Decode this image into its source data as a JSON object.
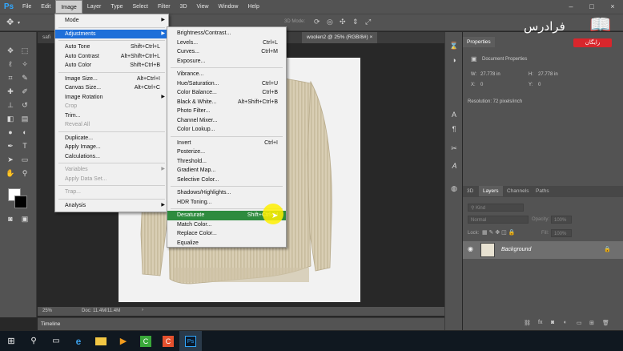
{
  "menubar": {
    "items": [
      "File",
      "Edit",
      "Image",
      "Layer",
      "Type",
      "Select",
      "Filter",
      "3D",
      "View",
      "Window",
      "Help"
    ],
    "active": "Image"
  },
  "optbar": {
    "mode_3d": "3D Mode:"
  },
  "tabs": [
    {
      "label": "safi"
    },
    {
      "label": "woolen2 @ 25% (RGB/8#)",
      "close": "×"
    }
  ],
  "statusbar": {
    "zoom": "25%",
    "doc": "Doc: 11.4M/11.4M"
  },
  "timeline": {
    "label": "Timeline"
  },
  "image_menu": {
    "items": [
      {
        "label": "Mode",
        "shortcut": "",
        "submenu": true,
        "disabled": false
      },
      {
        "sep": true
      },
      {
        "label": "Adjustments",
        "shortcut": "",
        "submenu": true,
        "disabled": false,
        "highlight": true
      },
      {
        "sep": true
      },
      {
        "label": "Auto Tone",
        "shortcut": "Shift+Ctrl+L",
        "disabled": false
      },
      {
        "label": "Auto Contrast",
        "shortcut": "Alt+Shift+Ctrl+L",
        "disabled": false
      },
      {
        "label": "Auto Color",
        "shortcut": "Shift+Ctrl+B",
        "disabled": false
      },
      {
        "sep": true
      },
      {
        "label": "Image Size...",
        "shortcut": "Alt+Ctrl+I",
        "disabled": false
      },
      {
        "label": "Canvas Size...",
        "shortcut": "Alt+Ctrl+C",
        "disabled": false
      },
      {
        "label": "Image Rotation",
        "shortcut": "",
        "submenu": true,
        "disabled": false
      },
      {
        "label": "Crop",
        "shortcut": "",
        "disabled": true
      },
      {
        "label": "Trim...",
        "shortcut": "",
        "disabled": false
      },
      {
        "label": "Reveal All",
        "shortcut": "",
        "disabled": true
      },
      {
        "sep": true
      },
      {
        "label": "Duplicate...",
        "shortcut": "",
        "disabled": false
      },
      {
        "label": "Apply Image...",
        "shortcut": "",
        "disabled": false
      },
      {
        "label": "Calculations...",
        "shortcut": "",
        "disabled": false
      },
      {
        "sep": true
      },
      {
        "label": "Variables",
        "shortcut": "",
        "submenu": true,
        "disabled": true
      },
      {
        "label": "Apply Data Set...",
        "shortcut": "",
        "disabled": true
      },
      {
        "sep": true
      },
      {
        "label": "Trap...",
        "shortcut": "",
        "disabled": true
      },
      {
        "sep": true
      },
      {
        "label": "Analysis",
        "shortcut": "",
        "submenu": true,
        "disabled": false
      }
    ]
  },
  "adjustments_menu": {
    "items": [
      {
        "label": "Brightness/Contrast...",
        "shortcut": ""
      },
      {
        "label": "Levels...",
        "shortcut": "Ctrl+L"
      },
      {
        "label": "Curves...",
        "shortcut": "Ctrl+M"
      },
      {
        "label": "Exposure...",
        "shortcut": ""
      },
      {
        "sep": true
      },
      {
        "label": "Vibrance...",
        "shortcut": ""
      },
      {
        "label": "Hue/Saturation...",
        "shortcut": "Ctrl+U"
      },
      {
        "label": "Color Balance...",
        "shortcut": "Ctrl+B"
      },
      {
        "label": "Black & White...",
        "shortcut": "Alt+Shift+Ctrl+B"
      },
      {
        "label": "Photo Filter...",
        "shortcut": ""
      },
      {
        "label": "Channel Mixer...",
        "shortcut": ""
      },
      {
        "label": "Color Lookup...",
        "shortcut": ""
      },
      {
        "sep": true
      },
      {
        "label": "Invert",
        "shortcut": "Ctrl+I"
      },
      {
        "label": "Posterize...",
        "shortcut": ""
      },
      {
        "label": "Threshold...",
        "shortcut": ""
      },
      {
        "label": "Gradient Map...",
        "shortcut": ""
      },
      {
        "label": "Selective Color...",
        "shortcut": ""
      },
      {
        "sep": true
      },
      {
        "label": "Shadows/Highlights...",
        "shortcut": ""
      },
      {
        "label": "HDR Toning...",
        "shortcut": ""
      },
      {
        "sep": true
      },
      {
        "label": "Desaturate",
        "shortcut": "Shift+Ctrl+U",
        "highlight": true
      },
      {
        "label": "Match Color...",
        "shortcut": ""
      },
      {
        "label": "Replace Color...",
        "shortcut": ""
      },
      {
        "label": "Equalize",
        "shortcut": ""
      }
    ]
  },
  "properties": {
    "tab": "Properties",
    "title": "Document Properties",
    "w_label": "W:",
    "w_value": "27.778 in",
    "h_label": "H:",
    "h_value": "27.778 in",
    "x_label": "X:",
    "x_value": "0",
    "y_label": "Y:",
    "y_value": "0",
    "resolution": "Resolution: 72 pixels/inch"
  },
  "layers": {
    "tabs": [
      "3D",
      "Layers",
      "Channels",
      "Paths"
    ],
    "active_tab": "Layers",
    "kind": "Kind",
    "blend_mode": "Normal",
    "opacity_label": "Opacity:",
    "opacity": "100%",
    "lock_label": "Lock:",
    "fill_label": "Fill:",
    "fill": "100%",
    "layer_name": "Background"
  },
  "logo": {
    "text": "فرادرس",
    "badge": "رایگان"
  },
  "colors": {
    "accent": "#1e6fd9",
    "highlight_green": "#2e8b3e",
    "ps_blue": "#31a8ff",
    "cursor": "#fff000"
  }
}
